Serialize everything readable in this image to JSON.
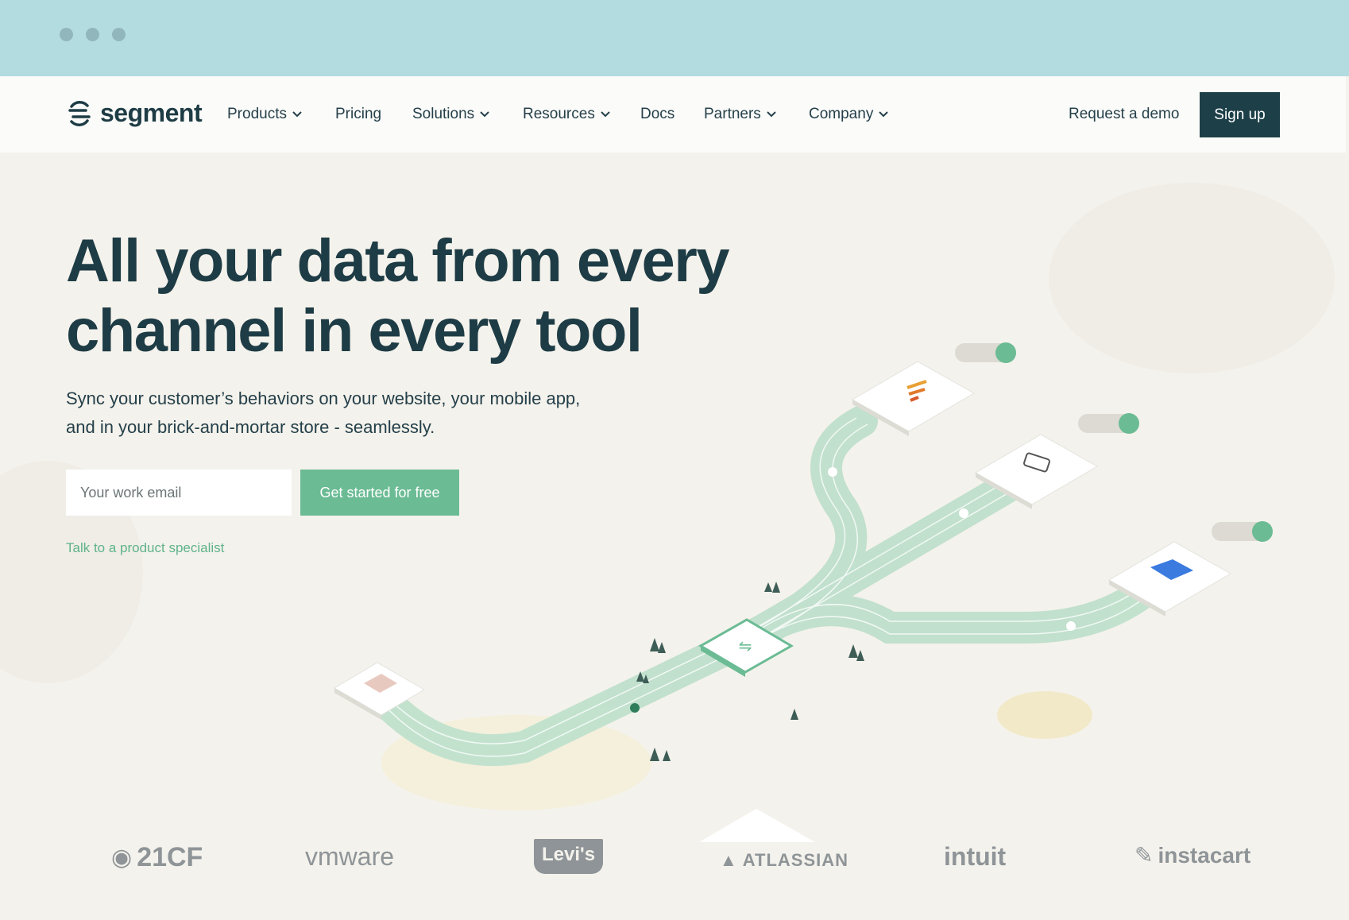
{
  "window": {
    "dots": [
      "close",
      "minimize",
      "zoom"
    ]
  },
  "nav": {
    "logo_text": "segment",
    "items": [
      {
        "label": "Products",
        "has_dropdown": true
      },
      {
        "label": "Pricing",
        "has_dropdown": false
      },
      {
        "label": "Solutions",
        "has_dropdown": true
      },
      {
        "label": "Resources",
        "has_dropdown": true
      },
      {
        "label": "Docs",
        "has_dropdown": false
      },
      {
        "label": "Partners",
        "has_dropdown": true
      },
      {
        "label": "Company",
        "has_dropdown": true
      }
    ],
    "request_demo": "Request a demo",
    "sign_up": "Sign up"
  },
  "hero": {
    "title_line1": "All your data from every",
    "title_line2": "channel in every tool",
    "subtitle_line1": "Sync your customer’s behaviors on your website, your mobile app,",
    "subtitle_line2": "and in your brick-and-mortar store - seamlessly.",
    "email_placeholder": "Your work email",
    "cta_label": "Get started for free",
    "specialist_link": "Talk to a product specialist"
  },
  "customers": [
    "21CF",
    "vmware",
    "Levi's",
    "ATLASSIAN",
    "intuit",
    "instacart"
  ],
  "colors": {
    "brand_dark": "#1d3f48",
    "accent_green": "#6bbb94",
    "titlebar": "#b3dce1",
    "background": "#f4f2ec"
  }
}
